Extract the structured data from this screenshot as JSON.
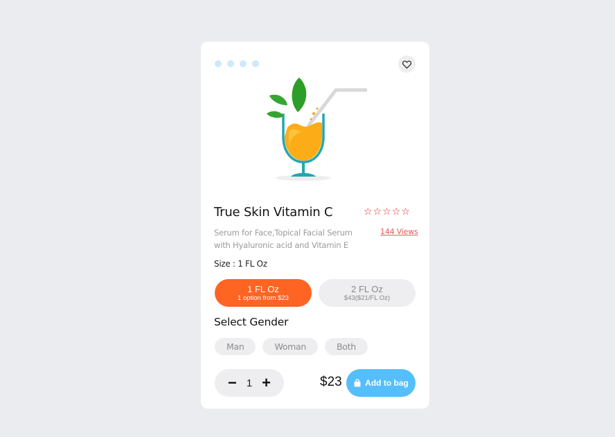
{
  "card": {
    "carousel_dots": 4,
    "favorite_icon": "heart-outline-icon",
    "product_image": "juice-glass-illustration",
    "title": "True Skin Vitamin C",
    "rating": {
      "stars_filled": 0,
      "stars_total": 5,
      "star_glyph": "☆",
      "color": "#e02424"
    },
    "description": "Serum for Face,Topical Facial Serum with Hyaluronic acid and Vitamin E",
    "views_link": "144 Views",
    "size_label": "Size : 1 FL Oz",
    "size_options": [
      {
        "label": "1 FL Oz",
        "sub": "1 option from $23",
        "selected": true
      },
      {
        "label": "2 FL Oz",
        "sub": "$43($21/FL Oz)",
        "selected": false
      }
    ],
    "gender_title": "Select Gender",
    "gender_options": [
      "Man",
      "Woman",
      "Both"
    ],
    "quantity": {
      "minus": "−",
      "value": "1",
      "plus": "+"
    },
    "price": "$23",
    "add_button": {
      "label": "Add to bag",
      "icon": "shopping-bag-icon"
    }
  },
  "colors": {
    "accent_orange": "#fe6422",
    "accent_blue": "#55befc",
    "background": "#ebecf0",
    "dot": "#cde9fb"
  }
}
